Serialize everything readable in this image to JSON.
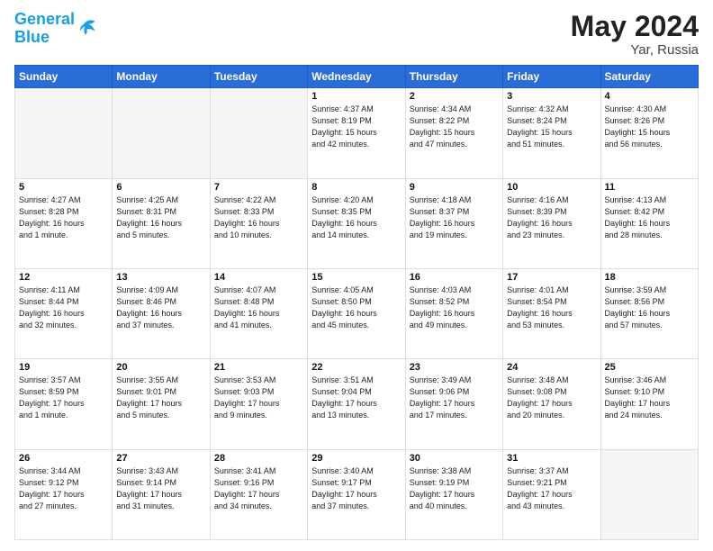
{
  "header": {
    "logo_line1": "General",
    "logo_line2": "Blue",
    "month_year": "May 2024",
    "location": "Yar, Russia"
  },
  "days_of_week": [
    "Sunday",
    "Monday",
    "Tuesday",
    "Wednesday",
    "Thursday",
    "Friday",
    "Saturday"
  ],
  "weeks": [
    [
      {
        "day": "",
        "info": ""
      },
      {
        "day": "",
        "info": ""
      },
      {
        "day": "",
        "info": ""
      },
      {
        "day": "1",
        "info": "Sunrise: 4:37 AM\nSunset: 8:19 PM\nDaylight: 15 hours\nand 42 minutes."
      },
      {
        "day": "2",
        "info": "Sunrise: 4:34 AM\nSunset: 8:22 PM\nDaylight: 15 hours\nand 47 minutes."
      },
      {
        "day": "3",
        "info": "Sunrise: 4:32 AM\nSunset: 8:24 PM\nDaylight: 15 hours\nand 51 minutes."
      },
      {
        "day": "4",
        "info": "Sunrise: 4:30 AM\nSunset: 8:26 PM\nDaylight: 15 hours\nand 56 minutes."
      }
    ],
    [
      {
        "day": "5",
        "info": "Sunrise: 4:27 AM\nSunset: 8:28 PM\nDaylight: 16 hours\nand 1 minute."
      },
      {
        "day": "6",
        "info": "Sunrise: 4:25 AM\nSunset: 8:31 PM\nDaylight: 16 hours\nand 5 minutes."
      },
      {
        "day": "7",
        "info": "Sunrise: 4:22 AM\nSunset: 8:33 PM\nDaylight: 16 hours\nand 10 minutes."
      },
      {
        "day": "8",
        "info": "Sunrise: 4:20 AM\nSunset: 8:35 PM\nDaylight: 16 hours\nand 14 minutes."
      },
      {
        "day": "9",
        "info": "Sunrise: 4:18 AM\nSunset: 8:37 PM\nDaylight: 16 hours\nand 19 minutes."
      },
      {
        "day": "10",
        "info": "Sunrise: 4:16 AM\nSunset: 8:39 PM\nDaylight: 16 hours\nand 23 minutes."
      },
      {
        "day": "11",
        "info": "Sunrise: 4:13 AM\nSunset: 8:42 PM\nDaylight: 16 hours\nand 28 minutes."
      }
    ],
    [
      {
        "day": "12",
        "info": "Sunrise: 4:11 AM\nSunset: 8:44 PM\nDaylight: 16 hours\nand 32 minutes."
      },
      {
        "day": "13",
        "info": "Sunrise: 4:09 AM\nSunset: 8:46 PM\nDaylight: 16 hours\nand 37 minutes."
      },
      {
        "day": "14",
        "info": "Sunrise: 4:07 AM\nSunset: 8:48 PM\nDaylight: 16 hours\nand 41 minutes."
      },
      {
        "day": "15",
        "info": "Sunrise: 4:05 AM\nSunset: 8:50 PM\nDaylight: 16 hours\nand 45 minutes."
      },
      {
        "day": "16",
        "info": "Sunrise: 4:03 AM\nSunset: 8:52 PM\nDaylight: 16 hours\nand 49 minutes."
      },
      {
        "day": "17",
        "info": "Sunrise: 4:01 AM\nSunset: 8:54 PM\nDaylight: 16 hours\nand 53 minutes."
      },
      {
        "day": "18",
        "info": "Sunrise: 3:59 AM\nSunset: 8:56 PM\nDaylight: 16 hours\nand 57 minutes."
      }
    ],
    [
      {
        "day": "19",
        "info": "Sunrise: 3:57 AM\nSunset: 8:59 PM\nDaylight: 17 hours\nand 1 minute."
      },
      {
        "day": "20",
        "info": "Sunrise: 3:55 AM\nSunset: 9:01 PM\nDaylight: 17 hours\nand 5 minutes."
      },
      {
        "day": "21",
        "info": "Sunrise: 3:53 AM\nSunset: 9:03 PM\nDaylight: 17 hours\nand 9 minutes."
      },
      {
        "day": "22",
        "info": "Sunrise: 3:51 AM\nSunset: 9:04 PM\nDaylight: 17 hours\nand 13 minutes."
      },
      {
        "day": "23",
        "info": "Sunrise: 3:49 AM\nSunset: 9:06 PM\nDaylight: 17 hours\nand 17 minutes."
      },
      {
        "day": "24",
        "info": "Sunrise: 3:48 AM\nSunset: 9:08 PM\nDaylight: 17 hours\nand 20 minutes."
      },
      {
        "day": "25",
        "info": "Sunrise: 3:46 AM\nSunset: 9:10 PM\nDaylight: 17 hours\nand 24 minutes."
      }
    ],
    [
      {
        "day": "26",
        "info": "Sunrise: 3:44 AM\nSunset: 9:12 PM\nDaylight: 17 hours\nand 27 minutes."
      },
      {
        "day": "27",
        "info": "Sunrise: 3:43 AM\nSunset: 9:14 PM\nDaylight: 17 hours\nand 31 minutes."
      },
      {
        "day": "28",
        "info": "Sunrise: 3:41 AM\nSunset: 9:16 PM\nDaylight: 17 hours\nand 34 minutes."
      },
      {
        "day": "29",
        "info": "Sunrise: 3:40 AM\nSunset: 9:17 PM\nDaylight: 17 hours\nand 37 minutes."
      },
      {
        "day": "30",
        "info": "Sunrise: 3:38 AM\nSunset: 9:19 PM\nDaylight: 17 hours\nand 40 minutes."
      },
      {
        "day": "31",
        "info": "Sunrise: 3:37 AM\nSunset: 9:21 PM\nDaylight: 17 hours\nand 43 minutes."
      },
      {
        "day": "",
        "info": ""
      }
    ]
  ]
}
